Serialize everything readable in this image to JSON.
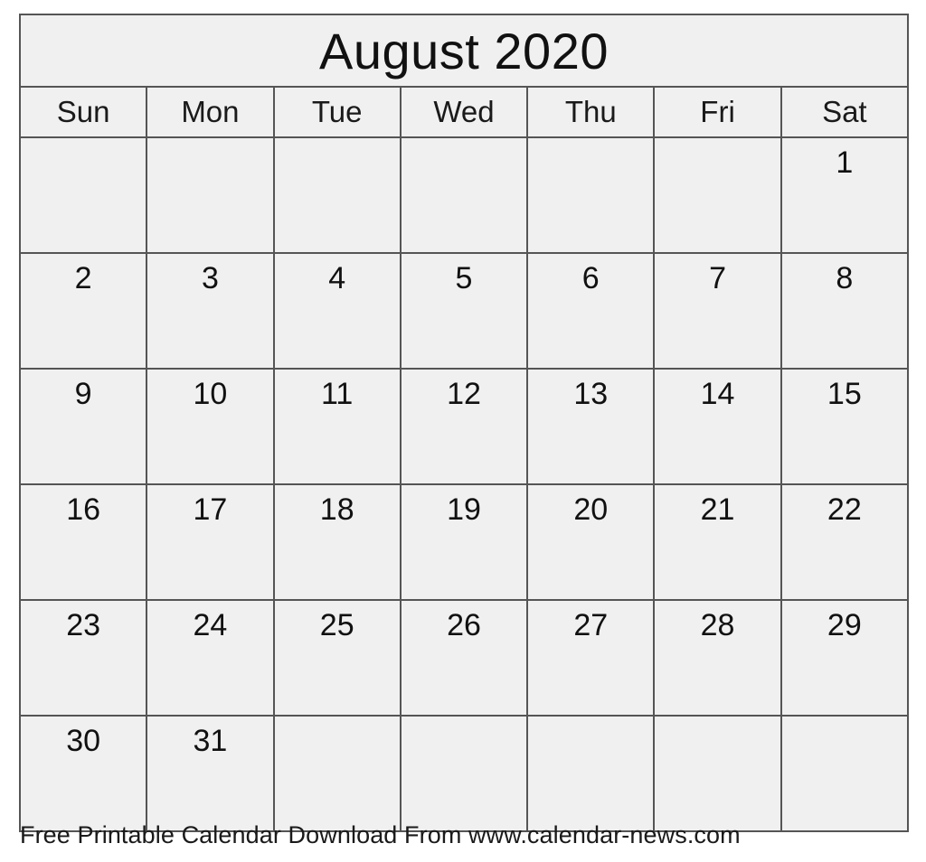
{
  "calendar": {
    "title": "August 2020",
    "month": "August",
    "year": "2020",
    "weekday_headers": [
      "Sun",
      "Mon",
      "Tue",
      "Wed",
      "Thu",
      "Fri",
      "Sat"
    ],
    "weeks": [
      [
        "",
        "",
        "",
        "",
        "",
        "",
        "1"
      ],
      [
        "2",
        "3",
        "4",
        "5",
        "6",
        "7",
        "8"
      ],
      [
        "9",
        "10",
        "11",
        "12",
        "13",
        "14",
        "15"
      ],
      [
        "16",
        "17",
        "18",
        "19",
        "20",
        "21",
        "22"
      ],
      [
        "23",
        "24",
        "25",
        "26",
        "27",
        "28",
        "29"
      ],
      [
        "30",
        "31",
        "",
        "",
        "",
        "",
        ""
      ]
    ],
    "colors": {
      "cell_background": "#f0f0f0",
      "border": "#555555",
      "text": "#111111",
      "page_background": "#ffffff"
    }
  },
  "footer": {
    "text": "Free Printable Calendar Download From www.calendar-news.com"
  }
}
